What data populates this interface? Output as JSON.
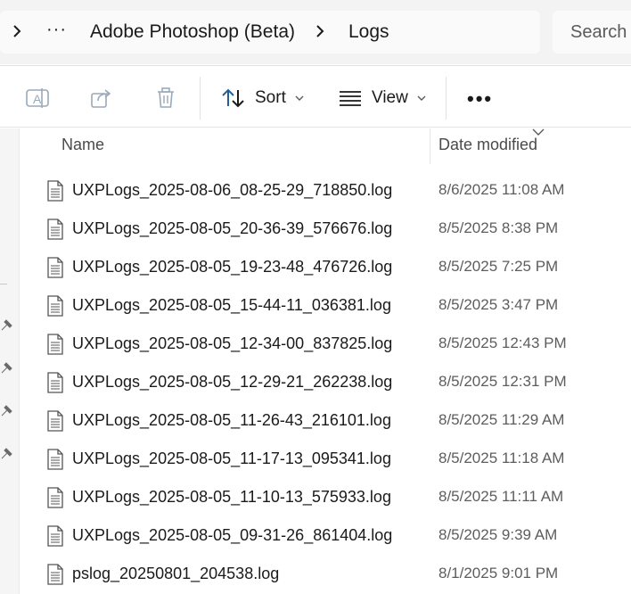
{
  "address": {
    "breadcrumb": [
      "Adobe Photoshop (Beta)",
      "Logs"
    ],
    "overflow_label": "···"
  },
  "search": {
    "placeholder": "Search"
  },
  "toolbar": {
    "sort_label": "Sort",
    "view_label": "View",
    "more_label": "•••"
  },
  "columns": {
    "name": "Name",
    "date_modified": "Date modified"
  },
  "files": [
    {
      "name": "UXPLogs_2025-08-06_08-25-29_718850.log",
      "date": "8/6/2025 11:08 AM"
    },
    {
      "name": "UXPLogs_2025-08-05_20-36-39_576676.log",
      "date": "8/5/2025 8:38 PM"
    },
    {
      "name": "UXPLogs_2025-08-05_19-23-48_476726.log",
      "date": "8/5/2025 7:25 PM"
    },
    {
      "name": "UXPLogs_2025-08-05_15-44-11_036381.log",
      "date": "8/5/2025 3:47 PM"
    },
    {
      "name": "UXPLogs_2025-08-05_12-34-00_837825.log",
      "date": "8/5/2025 12:43 PM"
    },
    {
      "name": "UXPLogs_2025-08-05_12-29-21_262238.log",
      "date": "8/5/2025 12:31 PM"
    },
    {
      "name": "UXPLogs_2025-08-05_11-26-43_216101.log",
      "date": "8/5/2025 11:29 AM"
    },
    {
      "name": "UXPLogs_2025-08-05_11-17-13_095341.log",
      "date": "8/5/2025 11:18 AM"
    },
    {
      "name": "UXPLogs_2025-08-05_11-10-13_575933.log",
      "date": "8/5/2025 11:11 AM"
    },
    {
      "name": "UXPLogs_2025-08-05_09-31-26_861404.log",
      "date": "8/5/2025 9:39 AM"
    },
    {
      "name": "pslog_20250801_204538.log",
      "date": "8/1/2025 9:01 PM"
    }
  ]
}
